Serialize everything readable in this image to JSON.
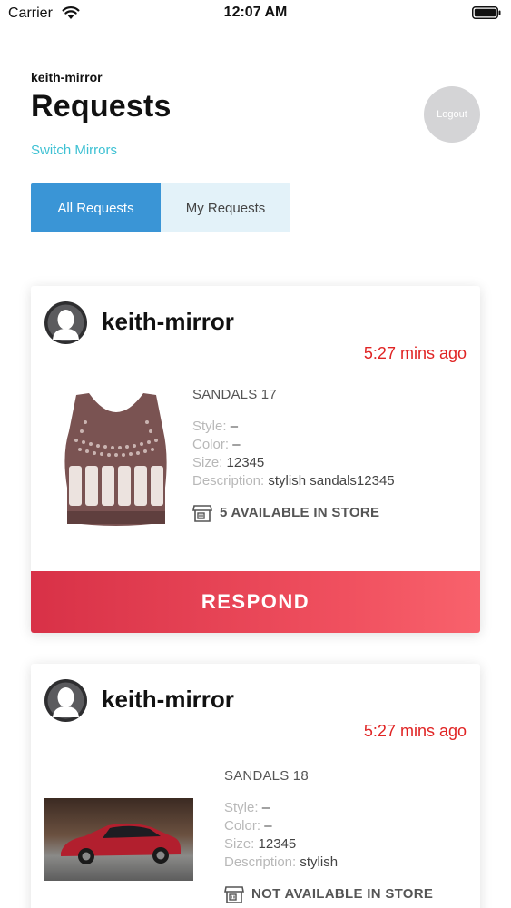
{
  "status_bar": {
    "carrier": "Carrier",
    "time": "12:07 AM"
  },
  "header": {
    "mirror_name": "keith-mirror",
    "title": "Requests",
    "switch_link": "Switch Mirrors",
    "logout_label": "Logout"
  },
  "tabs": [
    {
      "label": "All Requests",
      "active": true
    },
    {
      "label": "My Requests",
      "active": false
    }
  ],
  "labels": {
    "style": "Style:",
    "color": "Color:",
    "size": "Size:",
    "description": "Description:",
    "respond": "RESPOND"
  },
  "requests": [
    {
      "user": "keith-mirror",
      "time_ago": "5:27 mins ago",
      "product_title": "SANDALS 17",
      "style": "–",
      "color": "–",
      "size": "12345",
      "description": "stylish sandals12345",
      "availability": "5 AVAILABLE IN STORE",
      "image_icon": "sports-bra-image"
    },
    {
      "user": "keith-mirror",
      "time_ago": "5:27 mins ago",
      "product_title": "SANDALS 18",
      "style": "–",
      "color": "–",
      "size": "12345",
      "description": "stylish",
      "availability": "NOT AVAILABLE IN STORE",
      "image_icon": "red-car-image"
    }
  ],
  "colors": {
    "accent_blue": "#3a95d6",
    "link_teal": "#3ec1d3",
    "time_red": "#e02424",
    "respond_red": "#e8404f"
  }
}
